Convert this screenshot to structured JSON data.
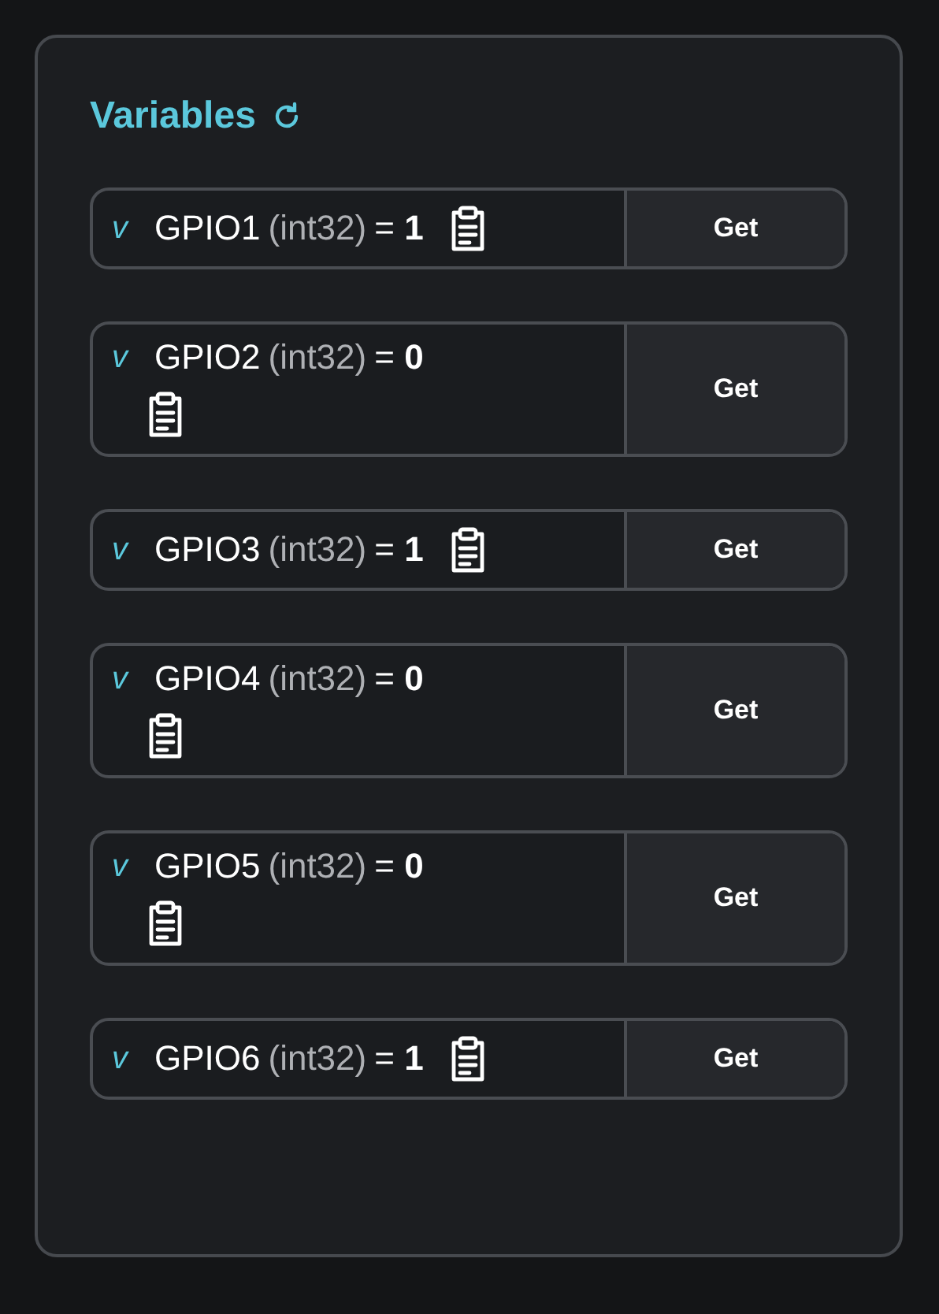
{
  "panel": {
    "title": "Variables",
    "variables": [
      {
        "prefix": "v",
        "name": "GPIO1",
        "type": "(int32)",
        "value": "= **1**",
        "kind": "inline",
        "button": "Get"
      },
      {
        "prefix": "v",
        "name": "GPIO2",
        "type": "(int32)",
        "value": "= **0**",
        "kind": "wrapped",
        "button": "Get"
      },
      {
        "prefix": "v",
        "name": "GPIO3",
        "type": "(int32)",
        "value": "= **1**",
        "kind": "inline",
        "button": "Get"
      },
      {
        "prefix": "v",
        "name": "GPIO4",
        "type": "(int32)",
        "value": "= **0**",
        "kind": "wrapped",
        "button": "Get"
      },
      {
        "prefix": "v",
        "name": "GPIO5",
        "type": "(int32)",
        "value": "= **0**",
        "kind": "wrapped",
        "button": "Get"
      },
      {
        "prefix": "v",
        "name": "GPIO6",
        "type": "(int32)",
        "value": "= **1**",
        "kind": "inline",
        "button": "Get"
      }
    ]
  }
}
